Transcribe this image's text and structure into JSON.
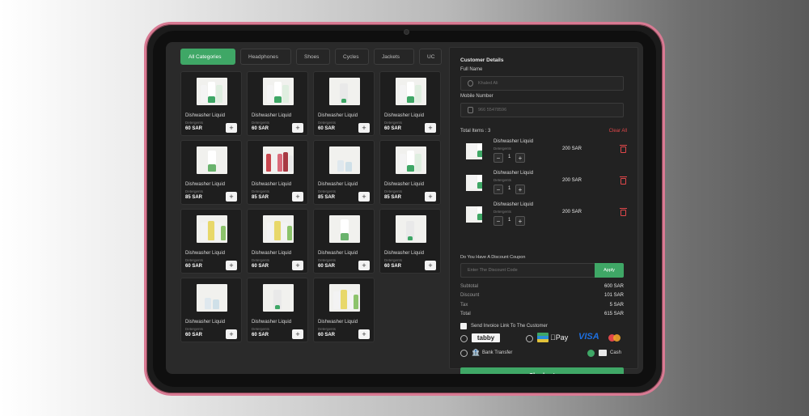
{
  "tabs": [
    "All Categories",
    "Headphones",
    "Shoes",
    "Cycles",
    "Jackets",
    "UC"
  ],
  "products": [
    {
      "name": "Dishwasher Liquid",
      "category": "Detergents",
      "price": "60 SAR",
      "style": "pack"
    },
    {
      "name": "Dishwasher Liquid",
      "category": "Detergents",
      "price": "60 SAR",
      "style": "pack"
    },
    {
      "name": "Dishwasher Liquid",
      "category": "Detergents",
      "price": "60 SAR",
      "style": "spray"
    },
    {
      "name": "Dishwasher Liquid",
      "category": "Detergents",
      "price": "60 SAR",
      "style": "pack"
    },
    {
      "name": "Dishwasher Liquid",
      "category": "Detergents",
      "price": "85 SAR",
      "style": "single"
    },
    {
      "name": "Dishwasher Liquid",
      "category": "Detergents",
      "price": "85 SAR",
      "style": "red"
    },
    {
      "name": "Dishwasher Liquid",
      "category": "Detergents",
      "price": "85 SAR",
      "style": "small"
    },
    {
      "name": "Dishwasher Liquid",
      "category": "Detergents",
      "price": "85 SAR",
      "style": "pack"
    },
    {
      "name": "Dishwasher Liquid",
      "category": "Detergents",
      "price": "60 SAR",
      "style": "yellow"
    },
    {
      "name": "Dishwasher Liquid",
      "category": "Detergents",
      "price": "60 SAR",
      "style": "yellow"
    },
    {
      "name": "Dishwasher Liquid",
      "category": "Detergents",
      "price": "60 SAR",
      "style": "single"
    },
    {
      "name": "Dishwasher Liquid",
      "category": "Detergents",
      "price": "60 SAR",
      "style": "spray"
    },
    {
      "name": "Dishwasher Liquid",
      "category": "Detergents",
      "price": "60 SAR",
      "style": "small"
    },
    {
      "name": "Dishwasher Liquid",
      "category": "Detergents",
      "price": "60 SAR",
      "style": "spray"
    },
    {
      "name": "Dishwasher Liquid",
      "category": "Detergents",
      "price": "60 SAR",
      "style": "yellow"
    }
  ],
  "customer": {
    "title": "Customer Details",
    "full_name_label": "Full Name",
    "full_name_placeholder": "Khaled Ali",
    "mobile_label": "Mobile Number",
    "mobile_placeholder": "966 55478596"
  },
  "cart": {
    "total_items": "Total Items : 3",
    "clear_all": "Clear All",
    "items": [
      {
        "name": "Dishwasher Liquid",
        "category": "Detergents",
        "qty": "1",
        "price": "200 SAR"
      },
      {
        "name": "Dishwasher Liquid",
        "category": "Detergents",
        "qty": "1",
        "price": "200 SAR"
      },
      {
        "name": "Dishwasher Liquid",
        "category": "Detergents",
        "qty": "1",
        "price": "200 SAR"
      }
    ]
  },
  "coupon": {
    "label": "Do You Have A Discount Coupon",
    "placeholder": "Enter The Discount Code",
    "apply": "Apply"
  },
  "summary": {
    "subtotal_label": "Subtotal",
    "subtotal": "600 SAR",
    "discount_label": "Discount",
    "discount": "101 SAR",
    "tax_label": "Tax",
    "tax": "5 SAR",
    "total_label": "Total",
    "total": "615 SAR"
  },
  "invoice_label": "Send Invoice Link To The Customer",
  "payments": {
    "tabby": "tabby",
    "applepay": "Pay",
    "visa": "VISA",
    "bank": "Bank Transfer",
    "cash": "Cash"
  },
  "checkout": "Checkout",
  "colors": {
    "accent": "#3fa766",
    "danger": "#e0474a",
    "frame": "#d87a93"
  }
}
